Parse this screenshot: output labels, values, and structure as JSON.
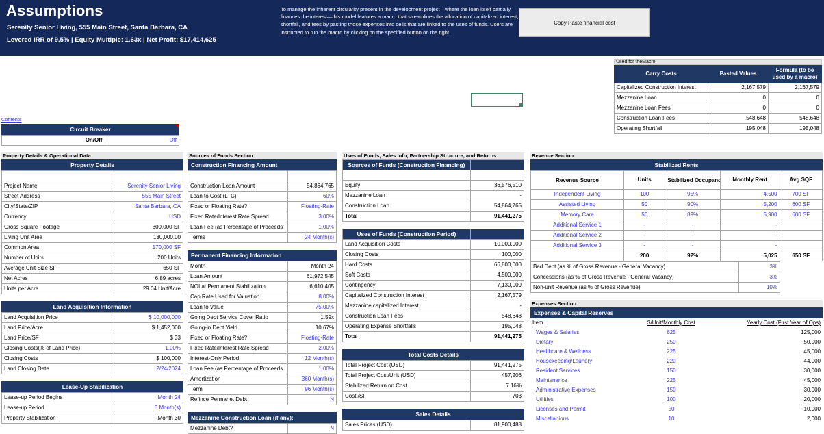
{
  "banner": {
    "title": "Assumptions",
    "subtitle": "Serenity Senior Living, 555 Main Street, Santa Barbara, CA",
    "metrics": "Levered IRR of 9.5% | Equity Multiple: 1.63x | Net Profit: $17,414,625",
    "description": "To manage the inherent circularity present in the development project—where the loan itself partially finances the interest—this model features a macro that streamlines the allocation of capitalized interest, shortfall, and fees by pasting those expenses into cells that are linked to the uses of funds. Users are instructed to run the macro by clicking on the specified button on the right.",
    "macro_button": "Copy Paste financial cost",
    "bg_color": "#14285a"
  },
  "macro_table": {
    "caption": "Used for theMacro",
    "headers": [
      "Carry Costs",
      "Pasted Values",
      "Formula (to be used by a macro)"
    ],
    "rows": [
      {
        "label": "Capitalized Construction Interest",
        "pasted": "2,167,579",
        "formula": "2,167,579"
      },
      {
        "label": "Mezzanine Loan",
        "pasted": "0",
        "formula": "0"
      },
      {
        "label": "Mezzanine Loan Fees",
        "pasted": "0",
        "formula": "0"
      },
      {
        "label": "Construction Loan Fees",
        "pasted": "548,648",
        "formula": "548,648"
      },
      {
        "label": "Operating Shortfall",
        "pasted": "195,048",
        "formula": "195,048"
      }
    ]
  },
  "contents_link": "Contents",
  "circuit_breaker": {
    "header": "Circuit Breaker",
    "label": "On/Off",
    "value": "Off"
  },
  "col1": {
    "section_label": "Property Details & Operational Data",
    "property_details": {
      "header": "Property Details",
      "rows": [
        {
          "label": "Project Name",
          "value": "Serenity Senior Living",
          "input": true
        },
        {
          "label": "Street Address",
          "value": "555 Main Street",
          "input": true
        },
        {
          "label": "City/State/ZIP",
          "value": "Santa Barbara, CA",
          "input": true
        },
        {
          "label": "Currency",
          "value": "USD",
          "input": true
        },
        {
          "label": "Gross Square Footage",
          "value": "300,000 SF",
          "input": false
        },
        {
          "label": "Living Unit Area",
          "value": "130,000.00",
          "input": false
        },
        {
          "label": "Common Area",
          "value": "170,000 SF",
          "input": true
        },
        {
          "label": "Number of  Units",
          "value": "200 Units",
          "input": false
        },
        {
          "label": "Average Unit Size SF",
          "value": "650 SF",
          "input": false
        },
        {
          "label": "Net Acres",
          "value": "6.89 acres",
          "input": false
        },
        {
          "label": "Units per Acre",
          "value": "29.04 Unit/Acre",
          "input": false
        }
      ]
    },
    "land_acquisition": {
      "header": "Land Acquisition Information",
      "rows": [
        {
          "label": "Land Acquisition  Price",
          "value": "$ 10,000,000",
          "input": true
        },
        {
          "label": "Land Price/Acre",
          "value": "$ 1,452,000",
          "input": false
        },
        {
          "label": "Land Price/SF",
          "value": "$ 33",
          "input": false
        },
        {
          "label": "Closing Costs(% of Land Price)",
          "value": "1.00%",
          "input": true
        },
        {
          "label": "Closing Costs",
          "value": "$ 100,000",
          "input": false
        },
        {
          "label": "Land Closing Date",
          "value": "2/24/2024",
          "input": true
        }
      ]
    },
    "lease_up": {
      "header": "Lease-Up Stabilization",
      "rows": [
        {
          "label": "Lease-up Period Begins",
          "value": "Month 24",
          "input": true
        },
        {
          "label": "Lease-up Period",
          "value": "6 Month(s)",
          "input": true
        },
        {
          "label": "Property Stabilization",
          "value": "Month 30",
          "input": false
        }
      ]
    }
  },
  "col2": {
    "section_label": "Sources of Funds Section:",
    "construction_financing": {
      "header": "Construction Financing Amount",
      "rows": [
        {
          "label": "Construction Loan Amount",
          "value": "54,864,765",
          "input": false
        },
        {
          "label": "Loan to Cost (LTC)",
          "value": "60%",
          "input": true
        },
        {
          "label": "Fixed or Floating Rate?",
          "value": "Floating-Rate",
          "input": true
        },
        {
          "label": "Fixed Rate/Interest Rate Spread",
          "value": "3.00%",
          "input": true
        },
        {
          "label": "Loan Fee (as Percentage of Proceeds",
          "value": "1.00%",
          "input": true
        },
        {
          "label": "Terms",
          "value": "24 Month(s)",
          "input": true
        }
      ]
    },
    "permanent_financing": {
      "header": "Permanent Financing Information",
      "rows": [
        {
          "label": "Month",
          "value": "Month 24",
          "input": false
        },
        {
          "label": "Loan Amount",
          "value": "61,972,545",
          "input": false
        },
        {
          "label": "NOI at Permanent Stabilization",
          "value": "6,610,405",
          "input": false
        },
        {
          "label": "Cap Rate Used for Valuation",
          "value": "8.00%",
          "input": true
        },
        {
          "label": "Loan to Value",
          "value": "75.00%",
          "input": true
        },
        {
          "label": "Going Debt Service Cover Ratio",
          "value": "1.59x",
          "input": false
        },
        {
          "label": "Going-in Debt Yield",
          "value": "10.67%",
          "input": false
        },
        {
          "label": "Fixed or Floating Rate?",
          "value": "Floating-Rate",
          "input": true
        },
        {
          "label": "Fixed Rate/Interest Rate Spread",
          "value": "2.00%",
          "input": true
        },
        {
          "label": "Interest-Only Period",
          "value": "12 Month(s)",
          "input": true
        },
        {
          "label": "Loan Fee (as Percentage of Proceeds",
          "value": "1.00%",
          "input": true
        },
        {
          "label": "Amortization",
          "value": "360 Month(s)",
          "input": true
        },
        {
          "label": "Term",
          "value": "96 Month(s)",
          "input": true
        },
        {
          "label": "Refince Permanet Debt",
          "value": "N",
          "input": true
        }
      ]
    },
    "mezzanine": {
      "header": "Mezzanine Construction Loan (if any):",
      "rows": [
        {
          "label": "Mezzanine Debt?",
          "value": "N",
          "input": true
        }
      ]
    }
  },
  "col3": {
    "section_label": "Uses of Funds, Sales Info, Partnership Structure, and Returns",
    "sources_of_funds": {
      "header": "Sources of Funds (Construction Financing)",
      "rows": [
        {
          "label": "Equity",
          "value": "36,576,510"
        },
        {
          "label": "Mezzanine Loan",
          "value": "-"
        },
        {
          "label": "Construction Loan",
          "value": "54,864,765"
        }
      ],
      "total_label": "Total",
      "total_value": "91,441,275"
    },
    "uses_of_funds": {
      "header": "Uses of Funds (Construction Period)",
      "rows": [
        {
          "label": "Land Acquisition Costs",
          "value": "10,000,000"
        },
        {
          "label": "Closing Costs",
          "value": "100,000"
        },
        {
          "label": "Hard Costs",
          "value": "66,800,000"
        },
        {
          "label": "Soft Costs",
          "value": "4,500,000"
        },
        {
          "label": "Contingency",
          "value": "7,130,000"
        },
        {
          "label": "Capitalized Construction Interest",
          "value": "2,167,579"
        },
        {
          "label": "Mezzanine capitalized Interest",
          "value": "-"
        },
        {
          "label": "Construction Loan Fees",
          "value": "548,648"
        },
        {
          "label": "Operating Expense Shortfalls",
          "value": "195,048"
        }
      ],
      "total_label": "Total",
      "total_value": "91,441,275"
    },
    "total_costs": {
      "header": "Total Costs Details",
      "rows": [
        {
          "label": "Total Project Cost (USD)",
          "value": "91,441,275"
        },
        {
          "label": "Total Project Cost/Unit (USD)",
          "value": "457,206"
        },
        {
          "label": "Stabilized Return on Cost",
          "value": "7.16%"
        },
        {
          "label": "Cost /SF",
          "value": "703"
        }
      ]
    },
    "sales_details": {
      "header": "Sales Details",
      "rows": [
        {
          "label": "Sales Prices (USD)",
          "value": "81,900,488"
        }
      ]
    }
  },
  "col4": {
    "section_label": "Revenue Section",
    "revenue": {
      "title": "Stabilized Rents",
      "headers": [
        "Revenue Source",
        "Units",
        "Stabilized Occupancy Rate",
        "Monthly Rent",
        "Avg SQF"
      ],
      "rows": [
        {
          "source": "Independent Living",
          "units": "100",
          "occupancy": "95%",
          "rent": "4,500",
          "sqf": "700 SF"
        },
        {
          "source": "Assisted Living",
          "units": "50",
          "occupancy": "90%",
          "rent": "5,200",
          "sqf": "600 SF"
        },
        {
          "source": "Memory Care",
          "units": "50",
          "occupancy": "89%",
          "rent": "5,900",
          "sqf": "600 SF"
        },
        {
          "source": "Additional Service 1",
          "units": "-",
          "occupancy": "-",
          "rent": "-",
          "sqf": ""
        },
        {
          "source": "Additional Service 2",
          "units": "-",
          "occupancy": "-",
          "rent": "-",
          "sqf": ""
        },
        {
          "source": "Additional Service 3",
          "units": "-",
          "occupancy": "-",
          "rent": "-",
          "sqf": ""
        }
      ],
      "totals": {
        "source": "",
        "units": "200",
        "occupancy": "92%",
        "rent": "5,025",
        "sqf": "650 SF"
      },
      "adjustments": [
        {
          "label": "Bad Debt (as % of Gross Revenue - General Vacancy)",
          "value": "3%"
        },
        {
          "label": "Concessions (as % of Gross Revenue - General Vacancy)",
          "value": "3%"
        },
        {
          "label": "Non-unit Revenue (as % of Gross Revenue)",
          "value": "10%"
        }
      ]
    },
    "expenses": {
      "section_label": "Expenses Section",
      "header": "Expenses &  Capital Reserves",
      "col_headers": [
        "Item",
        "$/Unit/Monthly Cost",
        "Yearly Cost (First Year of Ops)"
      ],
      "rows": [
        {
          "item": "Wages & Salaries",
          "unit_cost": "625",
          "yearly": "125,000"
        },
        {
          "item": "Dietary",
          "unit_cost": "250",
          "yearly": "50,000"
        },
        {
          "item": "Healthcare & Wellness",
          "unit_cost": "225",
          "yearly": "45,000"
        },
        {
          "item": "Housekeeping/Laundry",
          "unit_cost": "220",
          "yearly": "44,000"
        },
        {
          "item": "Resident Services",
          "unit_cost": "150",
          "yearly": "30,000"
        },
        {
          "item": "Maintenance",
          "unit_cost": "225",
          "yearly": "45,000"
        },
        {
          "item": "Administrative Expenses",
          "unit_cost": "150",
          "yearly": "30,000"
        },
        {
          "item": "Utilities",
          "unit_cost": "100",
          "yearly": "20,000"
        },
        {
          "item": "Licenses and Permit",
          "unit_cost": "50",
          "yearly": "10,000"
        },
        {
          "item": "Miscellanious",
          "unit_cost": "10",
          "yearly": "2,000"
        }
      ]
    }
  },
  "colors": {
    "navy": "#1f3864",
    "banner": "#14285a",
    "input_blue": "#3a37d4",
    "selection_green": "#3a8a5f"
  }
}
